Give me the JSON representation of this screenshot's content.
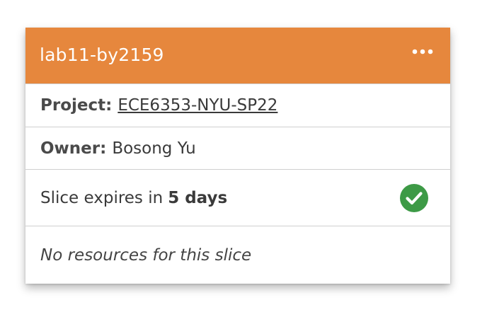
{
  "slice": {
    "title": "lab11-by2159",
    "menu_icon": "more-horizontal-icon",
    "project_label": "Project:",
    "project_name": "ECE6353-NYU-SP22",
    "owner_label": "Owner:",
    "owner_name": "Bosong Yu",
    "expiry_prefix": "Slice expires in",
    "expiry_value": "5 days",
    "status_icon": "check-circle-icon",
    "resources_text": "No resources for this slice"
  },
  "colors": {
    "header_bg": "#e6873d",
    "status_ok": "#3d9a46",
    "divider": "#cfcfcf"
  }
}
